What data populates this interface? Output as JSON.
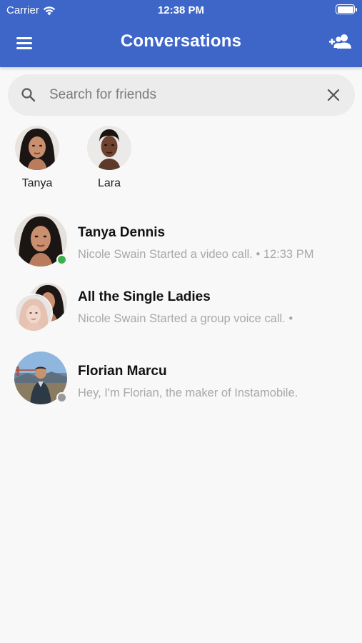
{
  "status_bar": {
    "carrier": "Carrier",
    "time": "12:38 PM"
  },
  "header": {
    "title": "Conversations",
    "menu_icon": "hamburger-menu-icon",
    "action_icon": "add-friend-icon"
  },
  "search": {
    "placeholder": "Search for friends",
    "value": ""
  },
  "friends": [
    {
      "name": "Tanya"
    },
    {
      "name": "Lara"
    }
  ],
  "conversations": [
    {
      "title": "Tanya Dennis",
      "subtitle": "Nicole Swain Started a video call. • 12:33 PM",
      "presence": "online"
    },
    {
      "title": "All the Single Ladies",
      "subtitle": "Nicole Swain Started a group voice call. •",
      "presence": ""
    },
    {
      "title": "Florian Marcu",
      "subtitle": "Hey, I'm Florian, the maker of Instamobile.",
      "presence": "offline"
    }
  ],
  "colors": {
    "header": "#3e66c9",
    "online": "#3db04a",
    "offline": "#9a9a9a",
    "background": "#f8f8f8",
    "subtitle": "#a8a8a8"
  }
}
